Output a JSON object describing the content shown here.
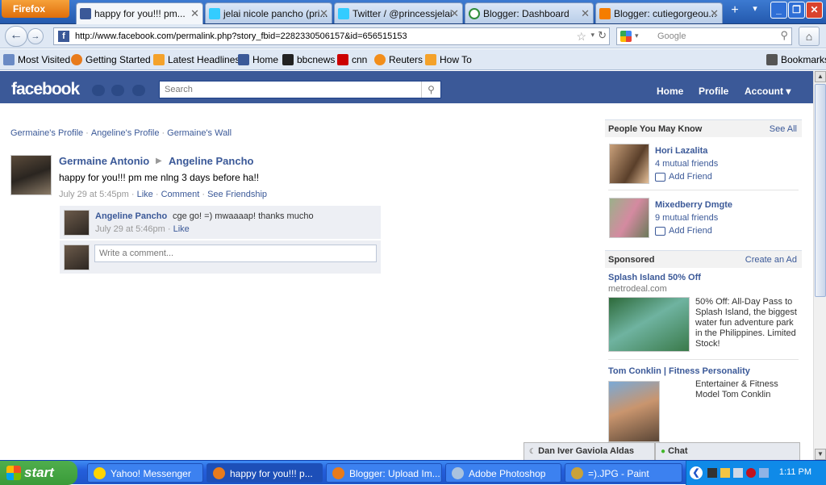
{
  "browser": {
    "menu_label": "Firefox",
    "tabs": [
      {
        "title": "happy for you!!! pm..."
      },
      {
        "title": "jelai nicole pancho (pri..."
      },
      {
        "title": "Twitter / @princessjelai"
      },
      {
        "title": "Blogger: Dashboard"
      },
      {
        "title": "Blogger: cutiegorgeou..."
      }
    ],
    "url": "http://www.facebook.com/permalink.php?story_fbid=228233050615​7&id=656515153",
    "search_placeholder": "Google",
    "bookmarks": [
      "Most Visited",
      "Getting Started",
      "Latest Headlines",
      "Home",
      "bbcnews",
      "cnn",
      "Reuters",
      "How To"
    ],
    "bookmarks_menu": "Bookmarks"
  },
  "facebook": {
    "logo": "facebook",
    "search_placeholder": "Search",
    "nav": {
      "home": "Home",
      "profile": "Profile",
      "account": "Account"
    },
    "breadcrumbs": [
      "Germaine's Profile",
      "Angeline's Profile",
      "Germaine's Wall"
    ],
    "story": {
      "author": "Germaine Antonio",
      "target": "Angeline Pancho",
      "text": "happy for you!!! pm me nlng 3 days before ha!!",
      "timestamp": "July 29 at 5:45pm",
      "actions": [
        "Like",
        "Comment",
        "See Friendship"
      ]
    },
    "comment": {
      "author": "Angeline Pancho",
      "text": "cge go! =) mwaaaap! thanks mucho",
      "timestamp": "July 29 at 5:46pm",
      "action": "Like"
    },
    "write_comment_placeholder": "Write a comment...",
    "pymk": {
      "heading": "People You May Know",
      "see_all": "See All",
      "people": [
        {
          "name": "Hori Lazalita",
          "mutual": "4 mutual friends",
          "add": "Add Friend"
        },
        {
          "name": "Mixedberry Dmgte",
          "mutual": "9 mutual friends",
          "add": "Add Friend"
        }
      ]
    },
    "sponsored": {
      "heading": "Sponsored",
      "create_ad": "Create an Ad",
      "ads": [
        {
          "title": "Splash Island 50% Off",
          "url": "metrodeal.com",
          "body": "50% Off: All-Day Pass to Splash Island, the biggest water fun adventure park in the Philippines. Limited Stock!"
        },
        {
          "title": "Tom Conklin | Fitness Personality",
          "body": "Entertainer & Fitness Model Tom Conklin"
        }
      ]
    },
    "chat_tab_person": "Dan Iver Gaviola Aldas",
    "chat_label": "Chat"
  },
  "taskbar": {
    "start": "start",
    "tasks": [
      "Yahoo! Messenger",
      "happy for you!!! p...",
      "Blogger: Upload Im...",
      "Adobe Photoshop",
      "=).JPG - Paint"
    ],
    "clock": "1:11 PM"
  },
  "colors": {
    "fb_blue": "#3b5998",
    "xp_blue": "#245edb",
    "start_green": "#3a9b39"
  }
}
